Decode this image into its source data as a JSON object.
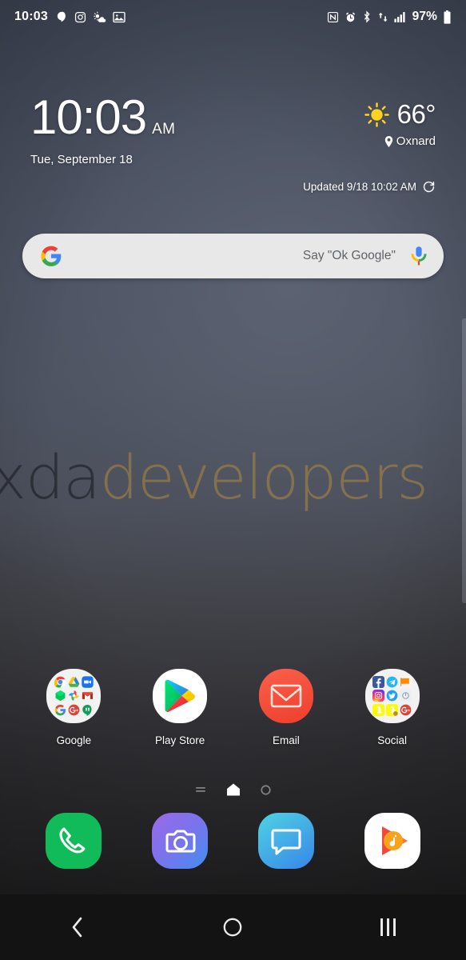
{
  "status_bar": {
    "time": "10:03",
    "battery": "97%",
    "left_icons": [
      "hangouts-icon",
      "instagram-icon",
      "weather-icon",
      "gallery-icon"
    ],
    "right_icons": [
      "nfc-icon",
      "alarm-icon",
      "bluetooth-icon",
      "data-transfer-icon",
      "signal-icon"
    ],
    "battery_level": 97
  },
  "widget": {
    "time": "10:03",
    "ampm": "AM",
    "date": "Tue, September 18",
    "weather": {
      "temperature": "66°",
      "condition_icon": "sun-icon",
      "location": "Oxnard",
      "updated": "Updated 9/18 10:02 AM",
      "refresh_icon": "refresh-icon"
    }
  },
  "search": {
    "logo_icon": "google-g-icon",
    "placeholder": "Say \"Ok Google\"",
    "mic_icon": "microphone-icon"
  },
  "watermark": {
    "part1": "xda",
    "part2": "developers",
    "color1": "#1a1c22",
    "color2": "#a88242"
  },
  "apps": [
    {
      "label": "Google",
      "type": "folder",
      "icons": [
        "chrome",
        "drive",
        "duo",
        "keep",
        "photos",
        "gmail",
        "google",
        "google-plus",
        "hangouts"
      ]
    },
    {
      "label": "Play Store",
      "type": "app",
      "icon": "play-store-icon"
    },
    {
      "label": "Email",
      "type": "app",
      "icon": "email-icon",
      "color": "#f4523a"
    },
    {
      "label": "Social",
      "type": "folder",
      "icons": [
        "facebook",
        "telegram",
        "flag",
        "instagram",
        "twitter",
        "grey-circle",
        "snapchat",
        "snapchat2",
        "google-plus"
      ]
    }
  ],
  "page_indicator": {
    "pages": [
      "bixby-page",
      "home-page",
      "page-3"
    ],
    "active_index": 1
  },
  "dock": [
    {
      "label": "Phone",
      "icon": "phone-icon",
      "color": "#1bbc5c"
    },
    {
      "label": "Camera",
      "icon": "camera-icon",
      "color": "#7b68e8"
    },
    {
      "label": "Messages",
      "icon": "message-icon",
      "color": "#36c0e8"
    },
    {
      "label": "Play Music",
      "icon": "play-music-icon",
      "color": "#ffffff"
    }
  ],
  "nav_bar": {
    "back": "back-icon",
    "home": "home-icon",
    "recents": "recents-icon"
  }
}
